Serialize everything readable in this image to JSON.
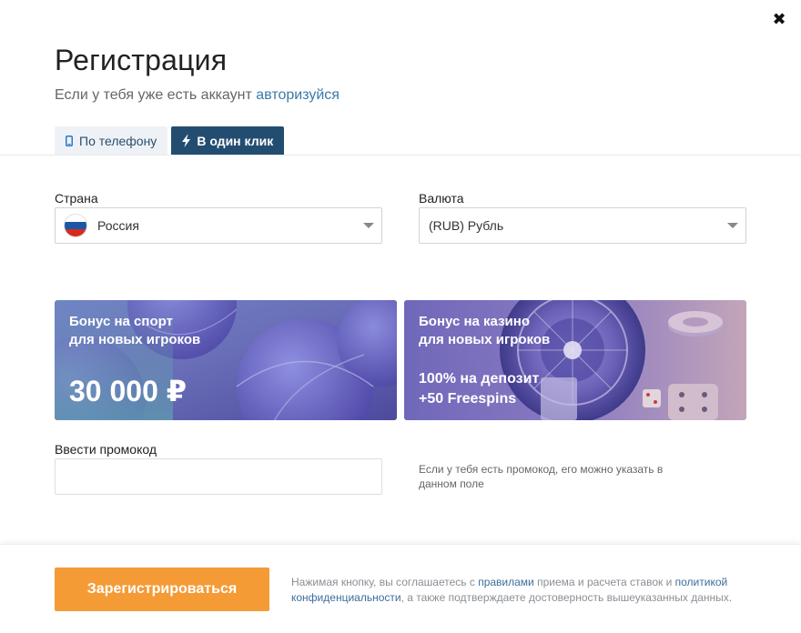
{
  "modal": {
    "close_icon": "close-icon",
    "title": "Регистрация",
    "subtitle_text": "Если у тебя уже есть аккаунт ",
    "subtitle_link": "авторизуйся"
  },
  "tabs": [
    {
      "label": "По телефону",
      "icon": "phone-icon",
      "active": false
    },
    {
      "label": "В один клик",
      "icon": "lightning-icon",
      "active": true
    }
  ],
  "form": {
    "country_label": "Страна",
    "country_value": "Россия",
    "currency_label": "Валюта",
    "currency_value": "(RUB) Рубль",
    "promo_label": "Ввести промокод",
    "promo_value": "",
    "promo_hint": "Если у тебя есть промокод, его можно указать в данном поле"
  },
  "banners": {
    "sport": {
      "line1": "Бонус на спорт",
      "line2": "для новых игроков",
      "amount": "30 000 ₽"
    },
    "casino": {
      "line1": "Бонус на казино",
      "line2": "для новых игроков",
      "offer1": "100% на депозит",
      "offer2": "+50 Freespins"
    }
  },
  "footer": {
    "register_button": "Зарегистрироваться",
    "legal_1": "Нажимая кнопку, вы соглашаетесь с ",
    "legal_link1": "правилами",
    "legal_2": " приема и расчета ставок и ",
    "legal_link2": "политикой конфиденциальности",
    "legal_3": ", а также подтверждаете достоверность вышеуказанных данных."
  },
  "colors": {
    "accent_orange": "#f59b36",
    "tab_active": "#234d70",
    "link": "#3d7aa8"
  }
}
